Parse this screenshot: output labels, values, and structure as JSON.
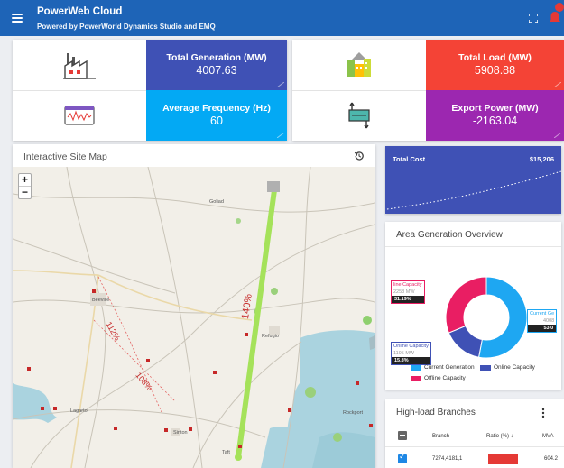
{
  "header": {
    "title": "PowerWeb Cloud",
    "subtitle": "Powered by PowerWorld Dynamics Studio and EMQ",
    "bg_color": "#1e64b7"
  },
  "kpis": [
    {
      "label": "Total Generation (MW)",
      "value": "4007.63",
      "color": "#3f51b5",
      "icon": "factory-icon"
    },
    {
      "label": "Total Load (MW)",
      "value": "5908.88",
      "color": "#f44336",
      "icon": "city-load-icon"
    },
    {
      "label": "Average Frequency (Hz)",
      "value": "60",
      "color": "#03a9f4",
      "icon": "frequency-waveform-icon"
    },
    {
      "label": "Export Power (MW)",
      "value": "-2163.04",
      "color": "#9c27b0",
      "icon": "power-exchange-icon"
    }
  ],
  "map": {
    "title": "Interactive Site Map",
    "zoom_in": "+",
    "zoom_out": "−",
    "place_labels": [
      "Goliad",
      "Beeville",
      "Refugio",
      "Sinton",
      "Taft",
      "Rockport",
      "Lagarto"
    ],
    "line_labels": [
      "140%",
      "112%",
      "108%"
    ],
    "colors": {
      "overload_line": "#a5e25a",
      "label_red": "#c62828"
    }
  },
  "total_cost": {
    "label": "Total Cost",
    "value": "$15,206",
    "color": "#3f51b5"
  },
  "area_generation": {
    "title": "Area Generation Overview",
    "callouts": [
      {
        "name": "line Capacity",
        "mw": "2258 MW",
        "pct": "31.19%"
      },
      {
        "name": "Current Ge",
        "mw": "4008",
        "pct": "53.0"
      },
      {
        "name": "Online Capacity",
        "mw": "1195 MW",
        "pct": "15.8%"
      }
    ],
    "legend": [
      {
        "label": "Current Generation",
        "color": "#1ea7f2"
      },
      {
        "label": "Online Capacity",
        "color": "#3f51b5"
      },
      {
        "label": "Offline Capacity",
        "color": "#e91e63"
      }
    ],
    "chart_data": {
      "type": "pie",
      "categories": [
        "Current Generation",
        "Online Capacity",
        "Offline Capacity"
      ],
      "values": [
        53.0,
        15.8,
        31.19
      ]
    }
  },
  "branches": {
    "title": "High-load Branches",
    "columns": [
      "Branch",
      "Ratio (%) ↓",
      "MVA"
    ],
    "rows": [
      {
        "branch": "7274,4181,1",
        "ratio": "",
        "mva": "604.2"
      }
    ]
  }
}
